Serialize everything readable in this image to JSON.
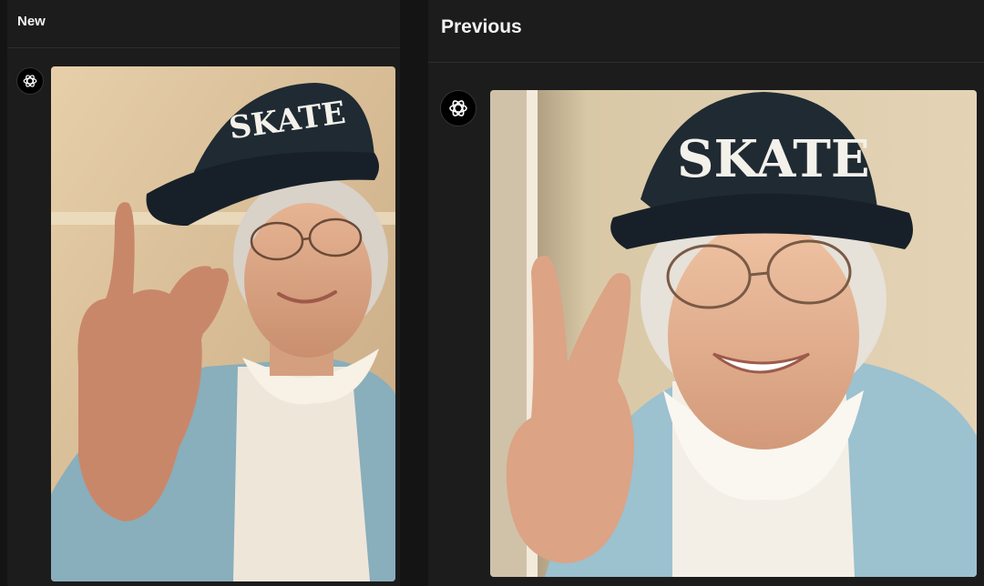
{
  "panels": {
    "left": {
      "title": "New",
      "avatar_icon": "openai-logo-icon",
      "image": {
        "description_hint": "elderly woman in SKATE cap making rock hand sign",
        "cap_text": "SKATE"
      }
    },
    "right": {
      "title": "Previous",
      "avatar_icon": "openai-logo-icon",
      "image": {
        "cap_text": "SKATE"
      }
    }
  },
  "colors": {
    "panel_bg": "#1c1c1c",
    "page_bg": "#141414",
    "title_text": "#f2f2f2",
    "cap": "#1f2a33",
    "cardigan": "#8fb4c2"
  }
}
